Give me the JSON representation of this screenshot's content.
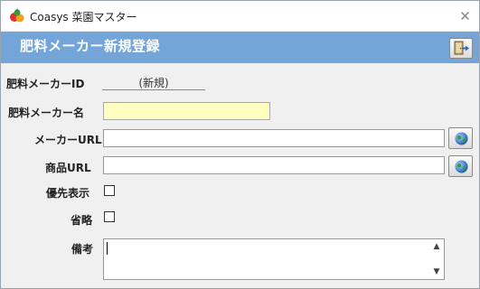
{
  "window": {
    "title": "Coasys 菜園マスター",
    "close_glyph": "✕"
  },
  "header": {
    "title": "肥料メーカー新規登録"
  },
  "form": {
    "id_label": "肥料メーカーID",
    "id_value": "(新規)",
    "name_label": "肥料メーカー名",
    "name_value": "",
    "maker_url_label": "メーカーURL",
    "maker_url_value": "",
    "product_url_label": "商品URL",
    "product_url_value": "",
    "priority_display_label": "優先表示",
    "priority_display_checked": false,
    "abbrev_label": "省略",
    "abbrev_checked": false,
    "notes_label": "備考",
    "notes_value": ""
  },
  "icons": {
    "app": "vegetable-app-icon",
    "exit": "exit-door-icon",
    "browse": "globe-icon"
  },
  "colors": {
    "header_bg": "#74a5d8",
    "required_bg": "#ffffc0",
    "window_bg": "#f0f0f0"
  }
}
